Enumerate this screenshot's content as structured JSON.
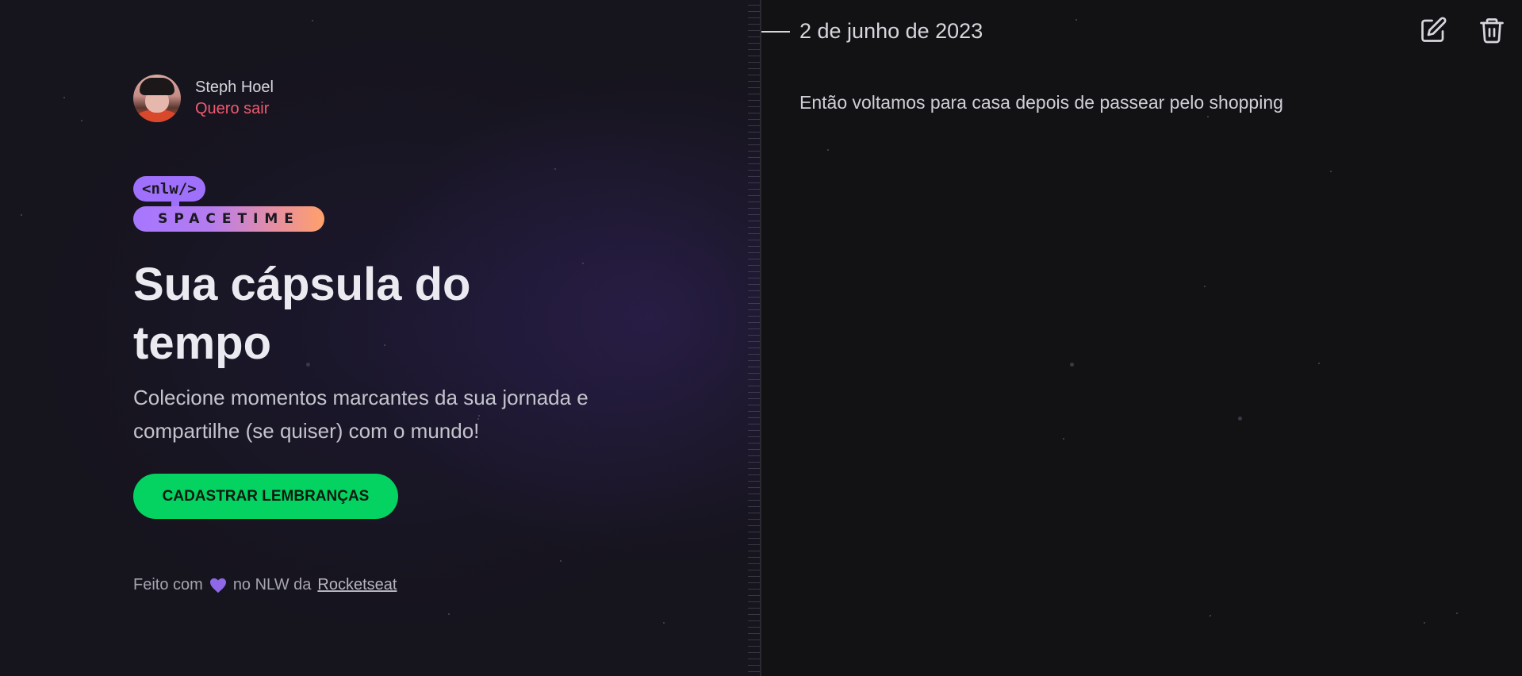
{
  "user": {
    "name": "Steph Hoel",
    "logout_label": "Quero sair"
  },
  "logo": {
    "top": "<nlw/>",
    "bottom": "SPACETIME",
    "top_color": "#9f70fb"
  },
  "hero": {
    "title": "Sua cápsula do tempo",
    "subtitle": "Colecione momentos marcantes da sua jornada e compartilhe (se quiser) com o mundo!",
    "cta_label": "CADASTRAR LEMBRANÇAS",
    "cta_color": "#04d361"
  },
  "footer": {
    "prefix": "Feito com",
    "heart_icon": "heart-icon",
    "middle": "no NLW da",
    "link_label": "Rocketseat"
  },
  "memory": {
    "date": "2 de junho de 2023",
    "text": "Então voltamos para casa depois de passear pelo shopping",
    "edit_icon": "edit-icon",
    "delete_icon": "trash-icon"
  },
  "colors": {
    "logout": "#ef5a6f",
    "background": "#121215"
  }
}
